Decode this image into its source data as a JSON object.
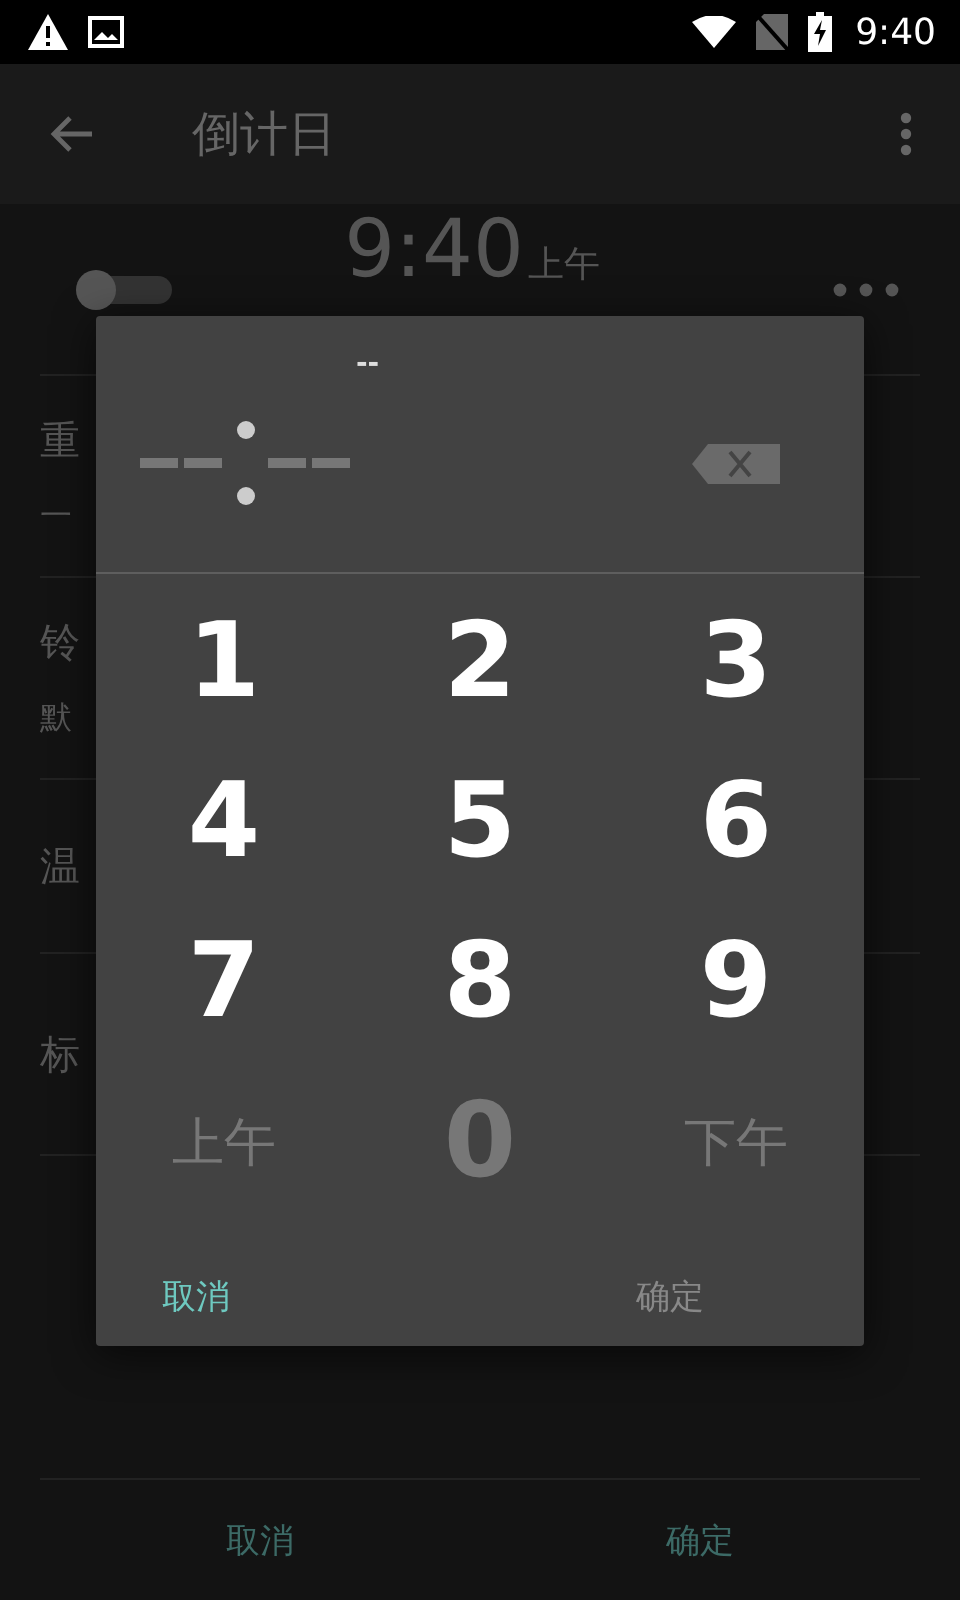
{
  "status_bar": {
    "time": "9:40"
  },
  "toolbar": {
    "title": "倒计日"
  },
  "alarm": {
    "on": false,
    "time": "9:40",
    "period": "上午"
  },
  "rows": [
    {
      "title": "重",
      "subtitle": "一"
    },
    {
      "title": "铃",
      "subtitle": "默"
    },
    {
      "title": "温"
    },
    {
      "title": "标"
    }
  ],
  "footer_buttons": [
    {
      "label": "取消"
    },
    {
      "label": "确定"
    }
  ],
  "dialog": {
    "period_display": "--",
    "keys": [
      {
        "label": "1",
        "disabled": false
      },
      {
        "label": "2",
        "disabled": false
      },
      {
        "label": "3",
        "disabled": false
      },
      {
        "label": "4",
        "disabled": false
      },
      {
        "label": "5",
        "disabled": false
      },
      {
        "label": "6",
        "disabled": false
      },
      {
        "label": "7",
        "disabled": false
      },
      {
        "label": "8",
        "disabled": false
      },
      {
        "label": "9",
        "disabled": false
      },
      {
        "label": "上午",
        "disabled": true
      },
      {
        "label": "0",
        "disabled": true
      },
      {
        "label": "下午",
        "disabled": true
      }
    ],
    "buttons": [
      {
        "label": "取消",
        "disabled": false
      },
      {
        "label": "确定",
        "disabled": true
      }
    ]
  }
}
